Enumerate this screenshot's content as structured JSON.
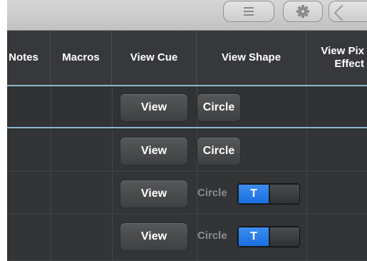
{
  "toolbar": {
    "buttons": [
      {
        "icon": "list-icon"
      },
      {
        "icon": "gear-icon"
      },
      {
        "icon": "window-icon"
      }
    ]
  },
  "columns": [
    {
      "label": "Notes"
    },
    {
      "label": "Macros"
    },
    {
      "label": "View Cue"
    },
    {
      "label": "View Shape"
    },
    {
      "label": "View Pix\nEffect"
    }
  ],
  "rows": [
    {
      "view_cue": "View",
      "view_shape": "Circle",
      "shape_enabled": true
    },
    {
      "view_cue": "View",
      "view_shape": "Circle",
      "shape_enabled": true
    },
    {
      "view_cue": "View",
      "view_shape": "Circle",
      "shape_enabled": false,
      "toggle_label": "T",
      "toggle_on": true
    },
    {
      "view_cue": "View",
      "view_shape": "Circle",
      "shape_enabled": false,
      "toggle_label": "T",
      "toggle_on": true
    }
  ],
  "colors": {
    "accent_toggle": "#1a6fe0",
    "row_separator": "#8eb7cc",
    "background": "#2f3032"
  }
}
